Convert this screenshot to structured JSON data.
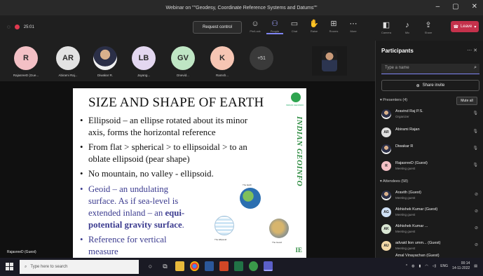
{
  "window": {
    "title": "Webinar on \"\"Geodesy, Coordinate Reference Systems and Datums\"\""
  },
  "toolbar": {
    "recording_timer": "25:01",
    "request_control": "Request control",
    "buttons": [
      {
        "label": "Pin/Lock",
        "icon": "reaction-icon"
      },
      {
        "label": "People",
        "icon": "people-icon"
      },
      {
        "label": "Chat",
        "icon": "chat-icon"
      },
      {
        "label": "Raise",
        "icon": "hand-icon"
      },
      {
        "label": "Rooms",
        "icon": "rooms-icon"
      },
      {
        "label": "More",
        "icon": "more-icon"
      }
    ],
    "right_buttons": [
      {
        "label": "Camera",
        "icon": "camera-icon"
      },
      {
        "label": "Mic",
        "icon": "mic-icon"
      },
      {
        "label": "Share",
        "icon": "share-icon"
      }
    ],
    "leave": "Leave"
  },
  "strip": {
    "avatars": [
      {
        "initials": "R",
        "name": "RajasreeD (Gue...",
        "color": "#f3c0c5"
      },
      {
        "initials": "AR",
        "name": "Abirami Raj...",
        "color": "#e2e2e2"
      },
      {
        "initials": "",
        "name": "Diwakar R.",
        "color": "photo"
      },
      {
        "initials": "LB",
        "name": "Jayang...",
        "color": "#e3d7f0"
      },
      {
        "initials": "GV",
        "name": "Dnevid...",
        "color": "#bfe6c4"
      },
      {
        "initials": "K",
        "name": "Ramsh...",
        "color": "#f6c5b3"
      }
    ],
    "more": "+51"
  },
  "slide": {
    "title": "SIZE AND SHAPE OF EARTH",
    "logo_text": "INDIAN GEOINFO",
    "vertical_text": "INDIAN GEOINFO",
    "bottom_mark": "IE",
    "b1_a": "Ellipsoid – an ellipse rotated about its minor",
    "b1_b": "axis, forms the horizontal reference",
    "b2_a": "From flat > spherical > to ellipsoidal > to an",
    "b2_b": "oblate ellipsoid (pear shape)",
    "b3": "No mountain, no valley - ellipsoid.",
    "b4_a": "Geoid – an undulating",
    "b4_b": "surface. As if sea-level is",
    "b4_c_pre": "extended inland – an ",
    "b4_c_bold": "equi-",
    "b4_d_bold": "potential gravity surface",
    "b4_d_post": ".",
    "b5_a": "Reference for vertical",
    "b5_b": "measure",
    "globe_captions": [
      "The Earth",
      "The Ellipsoid",
      "The Geoid"
    ]
  },
  "self_label": "RajasreeD (Guest)",
  "participants": {
    "title": "Participants",
    "search_placeholder": "Type a name",
    "share_invite": "Share invite",
    "presenters_label": "Presenters (4)",
    "mute_all": "Mute all",
    "presenters": [
      {
        "name": "Aravind Raj P.S.",
        "role": "Organizer",
        "initials": "",
        "color": "photo"
      },
      {
        "name": "Abirami Rajan",
        "role": "",
        "initials": "AR",
        "color": "#e0e0e0"
      },
      {
        "name": "Diwakar R",
        "role": "",
        "initials": "",
        "color": "photo"
      },
      {
        "name": "RajasreeD (Guest)",
        "role": "Meeting guest",
        "initials": "R",
        "color": "#f3c0c5"
      }
    ],
    "attendees_label": "Attendees (58)",
    "attendees": [
      {
        "name": "Aravith (Guest)",
        "role": "Meeting guest",
        "initials": "",
        "color": "photo"
      },
      {
        "name": "Abhishek Kumar (Guest)",
        "role": "Meeting guest",
        "initials": "AG",
        "color": "#cfe0f5"
      },
      {
        "name": "Abhishek Kumar ...",
        "role": "Meeting guest",
        "initials": "AK",
        "color": "#d9e6d3"
      },
      {
        "name": "advaid lion umm... (Guest)",
        "role": "Meeting guest",
        "initials": "AU",
        "color": "#f3d9a8"
      },
      {
        "name": "Amal Vinayachan (Guest)",
        "role": "",
        "initials": "",
        "color": "#cccccc"
      }
    ]
  },
  "taskbar": {
    "search_placeholder": "Type here to search",
    "time": "00:14",
    "date": "14-11-2022",
    "lang": "ENG"
  }
}
